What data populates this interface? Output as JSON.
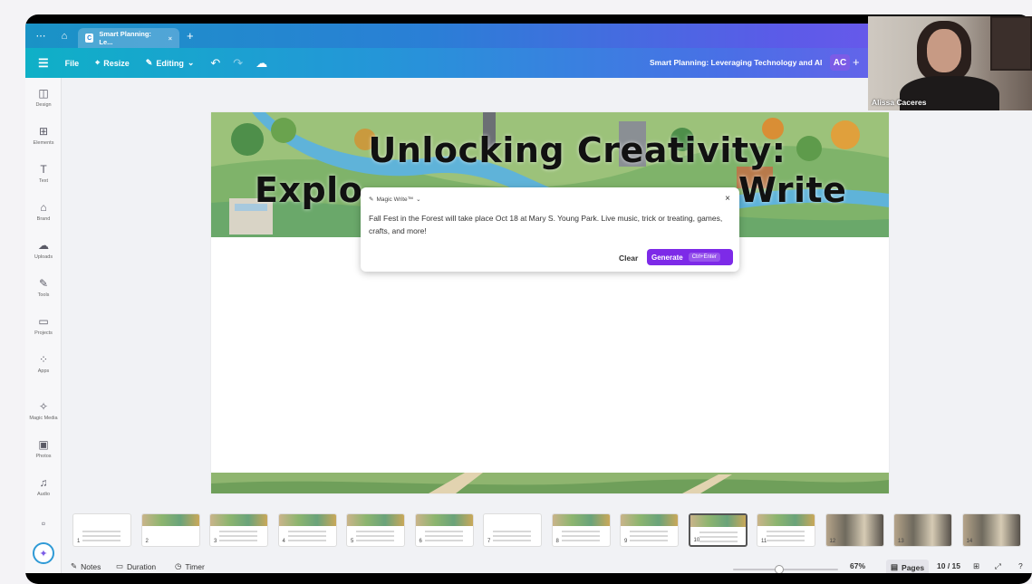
{
  "browser": {
    "tab_label": "Smart Planning: Le...",
    "tab_close": "×",
    "new_tab": "+"
  },
  "toolbar": {
    "file_label": "File",
    "resize_label": "Resize",
    "editing_label": "Editing",
    "doc_title": "Smart Planning: Leveraging Technology and AI",
    "avatar_initials": "AC",
    "share_plus": "+"
  },
  "sidebar": {
    "items": [
      {
        "label": "Design",
        "icon": "design-icon",
        "glyph": "◫"
      },
      {
        "label": "Elements",
        "icon": "elements-icon",
        "glyph": "⊞"
      },
      {
        "label": "Text",
        "icon": "text-icon",
        "glyph": "T"
      },
      {
        "label": "Brand",
        "icon": "brand-icon",
        "glyph": "⌂"
      },
      {
        "label": "Uploads",
        "icon": "uploads-icon",
        "glyph": "☁"
      },
      {
        "label": "Tools",
        "icon": "tools-icon",
        "glyph": "✎"
      },
      {
        "label": "Projects",
        "icon": "projects-icon",
        "glyph": "▭"
      },
      {
        "label": "Apps",
        "icon": "apps-icon",
        "glyph": "⁘"
      },
      {
        "label": "Magic Media",
        "icon": "magic-media-icon",
        "glyph": "✧"
      },
      {
        "label": "Photos",
        "icon": "photos-icon",
        "glyph": "▣"
      },
      {
        "label": "Audio",
        "icon": "audio-icon",
        "glyph": "♫"
      }
    ]
  },
  "slide": {
    "title_line1": "Unlocking Creativity:",
    "title_line2_left": "Explo",
    "title_line2_right": "Write"
  },
  "magic_write": {
    "header": "Magic Write™",
    "close": "×",
    "prompt_text": "Fall Fest in the Forest will take place Oct 18 at Mary S. Young Park. Live music, trick or treating, games, crafts, and more!",
    "clear_label": "Clear",
    "generate_label": "Generate",
    "shortcut_label": "Ctrl+Enter"
  },
  "thumbnails": [
    {
      "label": "1",
      "style": "blank"
    },
    {
      "label": "2",
      "style": "art"
    },
    {
      "label": "3",
      "style": "text"
    },
    {
      "label": "4",
      "style": "text"
    },
    {
      "label": "5",
      "style": "text"
    },
    {
      "label": "6",
      "style": "text"
    },
    {
      "label": "7",
      "style": "blank"
    },
    {
      "label": "8",
      "style": "text"
    },
    {
      "label": "9",
      "style": "text"
    },
    {
      "label": "10",
      "style": "active"
    },
    {
      "label": "11",
      "style": "text"
    },
    {
      "label": "12",
      "style": "photo"
    },
    {
      "label": "13",
      "style": "photo"
    },
    {
      "label": "14",
      "style": "photo"
    }
  ],
  "bottombar": {
    "notes_label": "Notes",
    "duration_label": "Duration",
    "timer_label": "Timer",
    "zoom_value": "67%",
    "zoom_level": 0.44,
    "pages_label": "Pages",
    "page_indicator": "10 / 15"
  },
  "webcam": {
    "participant_name": "Alissa Caceres"
  }
}
